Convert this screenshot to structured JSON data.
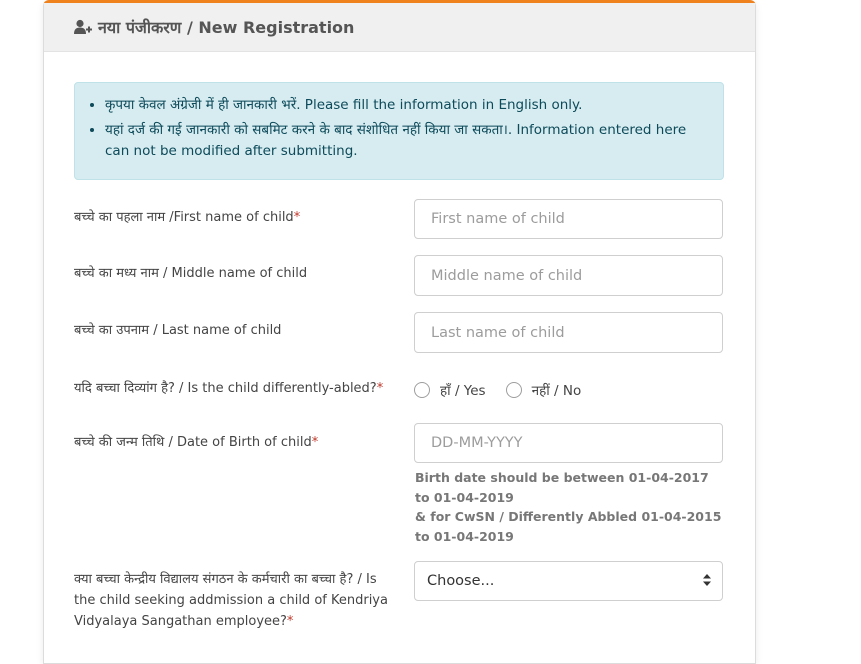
{
  "header": {
    "title": "नया पंजीकरण / New Registration",
    "icon": "user-plus-icon"
  },
  "alert": {
    "items": [
      "कृपया केवल अंग्रेजी में ही जानकारी भरें. Please fill the information in English only.",
      "यहां दर्ज की गई जानकारी को सबमिट करने के बाद संशोधित नहीं किया जा सकता।. Information entered here can not be modified after submitting."
    ]
  },
  "form": {
    "first_name": {
      "label": "बच्चे का पहला नाम /First name of child",
      "required": "*",
      "placeholder": "First name of child"
    },
    "middle_name": {
      "label": "बच्चे का मध्य नाम / Middle name of child",
      "placeholder": "Middle name of child"
    },
    "last_name": {
      "label": "बच्चे का उपनाम / Last name of child",
      "placeholder": "Last name of child"
    },
    "differently_abled": {
      "label": "यदि बच्चा दिव्यांग है? / Is the child differently-abled?",
      "required": "*",
      "yes": "हाँ / Yes",
      "no": "नहीं / No"
    },
    "dob": {
      "label": "बच्चे की जन्म तिथि / Date of Birth of child",
      "required": "*",
      "placeholder": "DD-MM-YYYY",
      "help": "Birth date should be between 01-04-2017 to 01-04-2019\n& for CwSN / Differently Abbled 01-04-2015 to 01-04-2019"
    },
    "kvs_employee": {
      "label": "क्या बच्चा केन्द्रीय विद्यालय संगठन के कर्मचारी का बच्चा है? / Is the child seeking addmission a child of Kendriya Vidyalaya Sangathan employee?",
      "required": "*",
      "selected": "Choose..."
    }
  },
  "colors": {
    "accent": "#f0821e",
    "alert_bg": "#d6ecf0",
    "required": "#c0392b"
  }
}
